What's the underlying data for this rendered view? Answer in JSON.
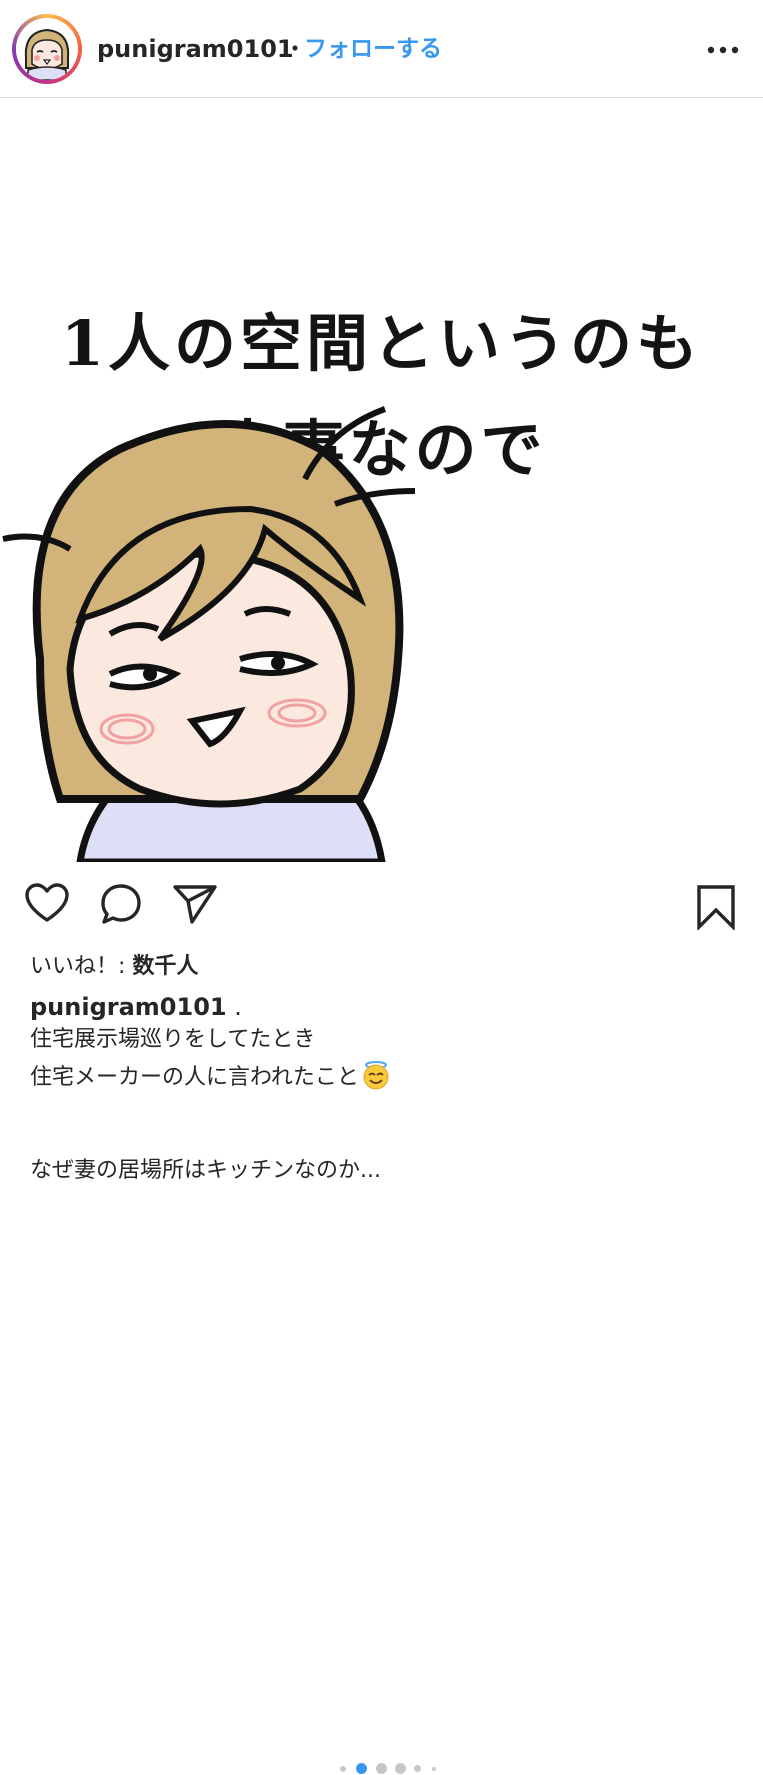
{
  "header": {
    "username": "punigram0101",
    "separator": "・",
    "follow_label": "フォローする",
    "avatar_icon": "user-avatar-illustration",
    "more_icon": "more-options-icon"
  },
  "post": {
    "image_text_line1": "1人の空間というのも",
    "image_text_line2": "大事なので",
    "illustration": "cartoon-girl-smirking"
  },
  "actions": {
    "like_icon": "heart-icon",
    "comment_icon": "comment-icon",
    "share_icon": "share-icon",
    "save_icon": "bookmark-icon",
    "carousel_count": 6,
    "carousel_active_index": 1
  },
  "likes": {
    "label": "いいね！: ",
    "count": "数千人"
  },
  "caption": {
    "username": "punigram0101",
    "username_suffix": " .",
    "line1": "住宅展示場巡りをしてたとき",
    "line2": "住宅メーカーの人に言われたこと",
    "line2_emoji": "smiling-face-with-halo-emoji",
    "line3": "なぜ妻の居場所はキッチンなのか..."
  },
  "colors": {
    "link_blue": "#3897f0",
    "text": "#262626",
    "divider": "#dbdbdb",
    "hair": "#d2b37a",
    "skin": "#fbe9e0",
    "blush": "#f1a1a1",
    "shirt": "#dcdff5"
  }
}
